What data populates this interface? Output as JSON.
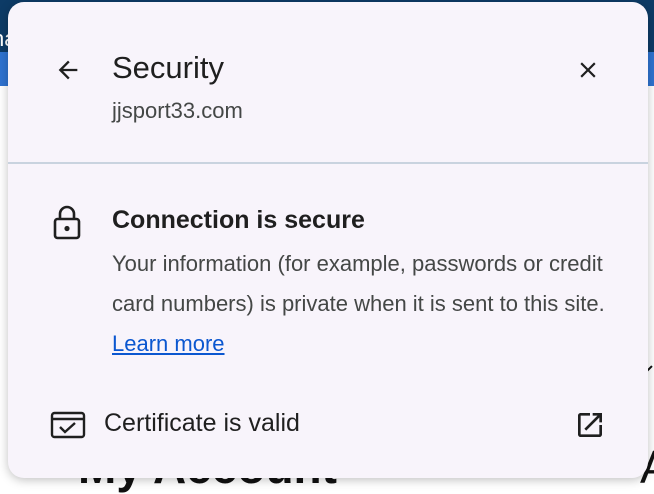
{
  "background": {
    "left_fragment": "na",
    "bottom_heading": "My Account",
    "right_fragment": "A"
  },
  "dialog": {
    "title": "Security",
    "site": "jjsport33.com",
    "connection": {
      "title": "Connection is secure",
      "description": "Your information (for example, passwords or credit card numbers) is private when it is sent to this site.",
      "learn_more": "Learn more"
    },
    "certificate": {
      "label": "Certificate is valid"
    },
    "icons": {
      "back": "arrow-back-icon",
      "close": "close-icon",
      "lock": "lock-icon",
      "certificate": "certificate-icon",
      "open_external": "open-in-new-icon"
    },
    "colors": {
      "link": "#0b57d0",
      "bubble_bg": "#f8f4fb"
    }
  }
}
